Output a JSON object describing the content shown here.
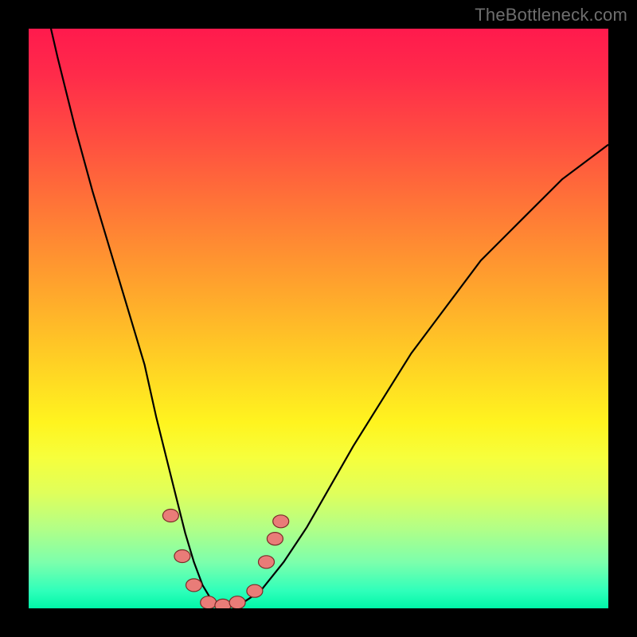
{
  "watermark": "TheBottleneck.com",
  "chart_data": {
    "type": "line",
    "title": "",
    "xlabel": "",
    "ylabel": "",
    "xlim": [
      0,
      100
    ],
    "ylim": [
      0,
      100
    ],
    "grid": false,
    "series": [
      {
        "name": "bottleneck-curve",
        "x": [
          0,
          2,
          5,
          8,
          11,
          14,
          17,
          20,
          22,
          24,
          25.5,
          27,
          28.5,
          30,
          31.5,
          33,
          35,
          37,
          40,
          44,
          48,
          52,
          56,
          61,
          66,
          72,
          78,
          85,
          92,
          100
        ],
        "y": [
          118,
          108,
          95,
          83,
          72,
          62,
          52,
          42,
          33,
          25,
          19,
          13,
          8,
          4,
          1.5,
          0.5,
          0.3,
          1,
          3,
          8,
          14,
          21,
          28,
          36,
          44,
          52,
          60,
          67,
          74,
          80
        ]
      }
    ],
    "markers": [
      {
        "x": 24.5,
        "y": 16
      },
      {
        "x": 26.5,
        "y": 9
      },
      {
        "x": 28.5,
        "y": 4
      },
      {
        "x": 31,
        "y": 1
      },
      {
        "x": 33.5,
        "y": 0.5
      },
      {
        "x": 36,
        "y": 1
      },
      {
        "x": 39,
        "y": 3
      },
      {
        "x": 41,
        "y": 8
      },
      {
        "x": 42.5,
        "y": 12
      },
      {
        "x": 43.5,
        "y": 15
      }
    ],
    "gradient_background": {
      "top_color": "#ff1a4d",
      "bottom_color": "#00f6a8",
      "description": "red-to-green vertical gradient indicating bottleneck severity"
    }
  }
}
